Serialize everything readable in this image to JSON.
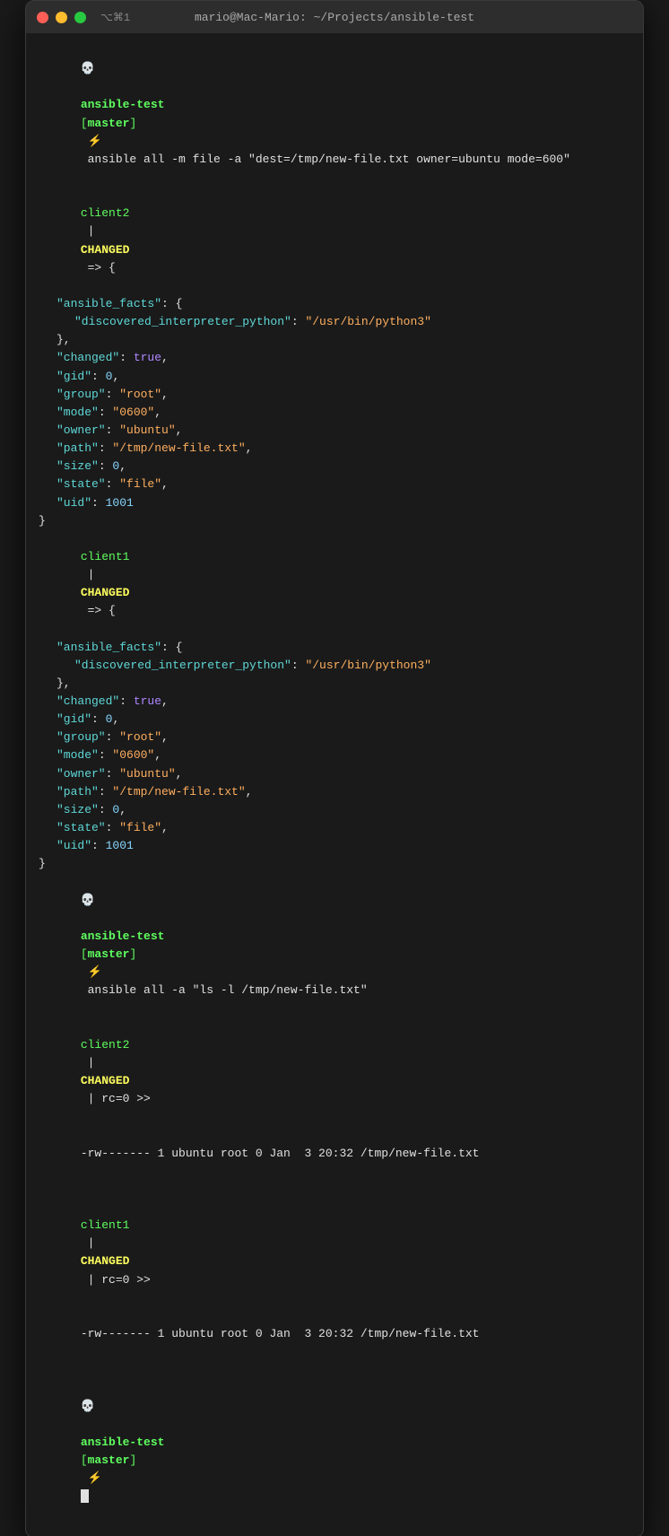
{
  "window": {
    "title": "mario@Mac-Mario: ~/Projects/ansible-test",
    "shortcut": "⌥⌘1"
  },
  "terminal": {
    "prompt1": {
      "skull": "💀",
      "name": "ansible-test",
      "branch": "master",
      "bolt": "⚡",
      "command": " ansible all -m file -a \"dest=/tmp/new-file.txt owner=ubuntu mode=600\""
    },
    "block1": {
      "client": "client2",
      "status": "CHANGED",
      "lines": [
        "    \"ansible_facts\": {",
        "        \"discovered_interpreter_python\": \"/usr/bin/python3\"",
        "    },",
        "    \"changed\": true,",
        "    \"gid\": 0,",
        "    \"group\": \"root\",",
        "    \"mode\": \"0600\",",
        "    \"owner\": \"ubuntu\",",
        "    \"path\": \"/tmp/new-file.txt\",",
        "    \"size\": 0,",
        "    \"state\": \"file\",",
        "    \"uid\": 1001"
      ]
    },
    "block2": {
      "client": "client1",
      "status": "CHANGED",
      "lines": [
        "    \"ansible_facts\": {",
        "        \"discovered_interpreter_python\": \"/usr/bin/python3\"",
        "    },",
        "    \"changed\": true,",
        "    \"gid\": 0,",
        "    \"group\": \"root\",",
        "    \"mode\": \"0600\",",
        "    \"owner\": \"ubuntu\",",
        "    \"path\": \"/tmp/new-file.txt\",",
        "    \"size\": 0,",
        "    \"state\": \"file\",",
        "    \"uid\": 1001"
      ]
    },
    "prompt2": {
      "skull": "💀",
      "name": "ansible-test",
      "branch": "master",
      "bolt": "⚡",
      "command": " ansible all -a \"ls -l /tmp/new-file.txt\""
    },
    "output2": {
      "client2_header": "client2 | CHANGED | rc=0 >>",
      "client2_file": "-rw------- 1 ubuntu root 0 Jan  3 20:32 /tmp/new-file.txt",
      "client1_header": "client1 | CHANGED | rc=0 >>",
      "client1_file": "-rw------- 1 ubuntu root 0 Jan  3 20:32 /tmp/new-file.txt"
    },
    "prompt3": {
      "skull": "💀",
      "name": "ansible-test",
      "branch": "master",
      "bolt": "⚡"
    }
  }
}
